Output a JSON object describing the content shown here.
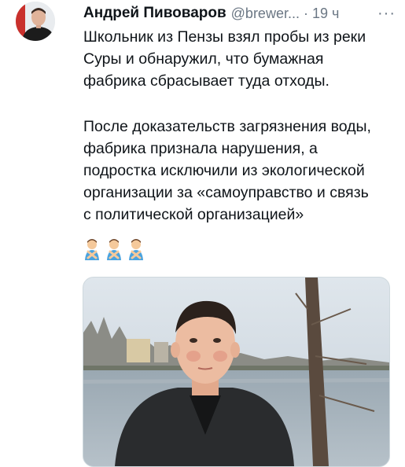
{
  "author": {
    "name": "Андрей Пивоваров",
    "handle": "@brewer...",
    "separator": "·",
    "time": "19 ч"
  },
  "more_label": "···",
  "tweet": {
    "paragraph1": "Школьник из Пензы взял пробы из реки\nСуры и обнаружил, что бумажная\nфабрика сбрасывает туда отходы.",
    "paragraph2": "После доказательств загрязнения воды,\nфабрика признала нарушения, а\nподростка исключили из экологической\nорганизации за «самоуправство и связь\nс политической организацией»"
  },
  "emojis": [
    "man-gesturing-no",
    "man-gesturing-no",
    "man-gesturing-no"
  ],
  "media": {
    "kind": "photo",
    "subject": "teenager standing by river"
  },
  "colors": {
    "secondary_text": "#6b7784",
    "primary_text": "#0f1419"
  }
}
